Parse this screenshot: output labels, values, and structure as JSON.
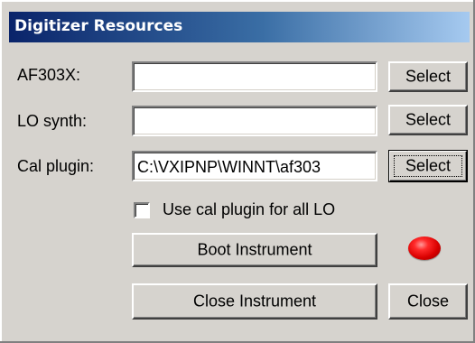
{
  "window": {
    "title": "Digitizer Resources"
  },
  "fields": [
    {
      "label": "AF303X:",
      "value": "",
      "button_label": "Select"
    },
    {
      "label": "LO synth:",
      "value": "",
      "button_label": "Select"
    },
    {
      "label": "Cal plugin:",
      "value": "C:\\VXIPNP\\WINNT\\af303",
      "button_label": "Select"
    }
  ],
  "options": {
    "use_cal_plugin_label": "Use cal plugin for all LO",
    "use_cal_plugin_checked": false
  },
  "actions": {
    "boot_label": "Boot Instrument",
    "close_instrument_label": "Close Instrument",
    "close_label": "Close"
  },
  "status": {
    "led_state": "red",
    "led_color": "#e00000"
  }
}
